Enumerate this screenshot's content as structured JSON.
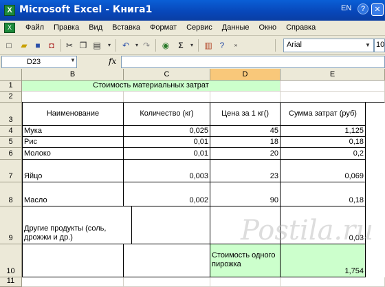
{
  "window": {
    "title": "Microsoft Excel - Книга1",
    "lang": "EN",
    "lang_help": "?",
    "sys_button": "✕"
  },
  "menu": {
    "items": [
      "Файл",
      "Правка",
      "Вид",
      "Вставка",
      "Формат",
      "Сервис",
      "Данные",
      "Окно",
      "Справка"
    ]
  },
  "toolbar": {
    "font_name": "Arial",
    "font_size": "10",
    "sum_symbol": "Σ"
  },
  "formula_bar": {
    "name_box": "D23",
    "fx_label": "fx",
    "value": ""
  },
  "columns": [
    "B",
    "C",
    "D",
    "E"
  ],
  "active_column": "D",
  "rows": [
    "1",
    "2",
    "3",
    "4",
    "5",
    "6",
    "7",
    "8",
    "9",
    "10",
    "11"
  ],
  "sheet": {
    "title": "Стоимость материальных затрат",
    "headers": {
      "name": "Наименование",
      "qty": "Количество (кг)",
      "price": "Цена за 1 кг()",
      "sum": "Сумма затрат (руб)"
    },
    "items": [
      {
        "name": "Мука",
        "qty": "0,025",
        "price": "45",
        "sum": "1,125"
      },
      {
        "name": "Рис",
        "qty": "0,01",
        "price": "18",
        "sum": "0,18"
      },
      {
        "name": "Молоко",
        "qty": "0,01",
        "price": "20",
        "sum": "0,2"
      },
      {
        "name": "Яйцо",
        "qty": "0,003",
        "price": "23",
        "sum": "0,069"
      },
      {
        "name": "Масло",
        "qty": "0,002",
        "price": "90",
        "sum": "0,18"
      },
      {
        "name": "Другие продукты (соль, дрожжи и др.)",
        "qty": "",
        "price": "",
        "sum": "0,03"
      }
    ],
    "total_label": "Стоимость одного пирожка",
    "total_value": "1,754"
  },
  "watermark": "Postila.ru",
  "colors": {
    "title_bar": "#0a5fd6",
    "highlight_green": "#ccffcc",
    "active_column": "#f9c87a"
  }
}
